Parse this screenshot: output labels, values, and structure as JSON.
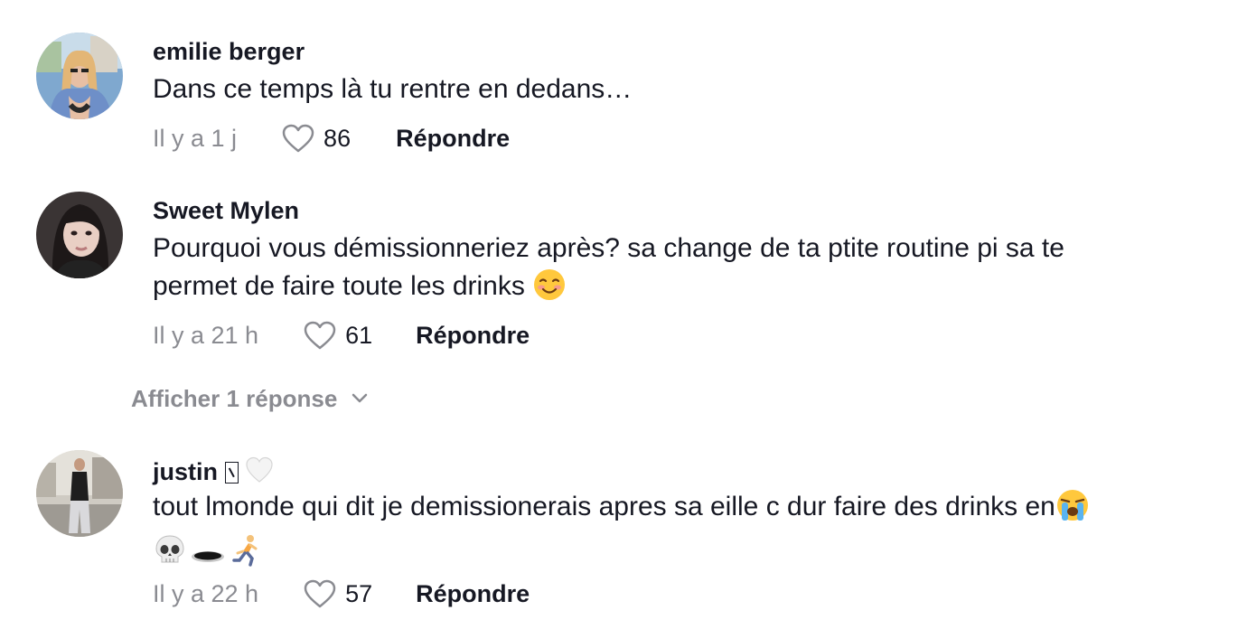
{
  "comments": [
    {
      "username": "emilie berger",
      "text": "Dans ce temps là tu rentre en dedans…",
      "time": "Il y a 1 j",
      "likes": "86",
      "reply_label": "Répondre",
      "avatar": "avatar-photo-blonde-woman"
    },
    {
      "username": "Sweet Mylen",
      "text_line1": "Pourquoi vous démissionneriez après? sa change de ta ptite routine pi sa te",
      "text_line2": "permet de faire toute les drinks",
      "text_emoji": "smiling-face-emoji",
      "time": "Il y a 21 h",
      "likes": "61",
      "reply_label": "Répondre",
      "avatar": "avatar-photo-dark-hair-woman",
      "show_replies_label": "Afficher 1 réponse"
    },
    {
      "username": "justin",
      "username_badges": [
        "missing-glyph-box",
        "white-heart-emoji"
      ],
      "text_line1": "tout lmonde qui dit je demissionerais apres sa eille c dur faire des drinks en",
      "text_line1_emoji": "loudly-crying-face-emoji",
      "text_line2_emojis": [
        "skull-emoji",
        "hole-emoji",
        "person-running-emoji"
      ],
      "time": "Il y a 22 h",
      "likes": "57",
      "reply_label": "Répondre",
      "avatar": "avatar-photo-man-street"
    }
  ],
  "icons": {
    "like": "heart-outline-icon",
    "expand": "chevron-down-icon"
  },
  "colors": {
    "text": "#161823",
    "muted": "#8a8b91",
    "background": "#ffffff"
  }
}
